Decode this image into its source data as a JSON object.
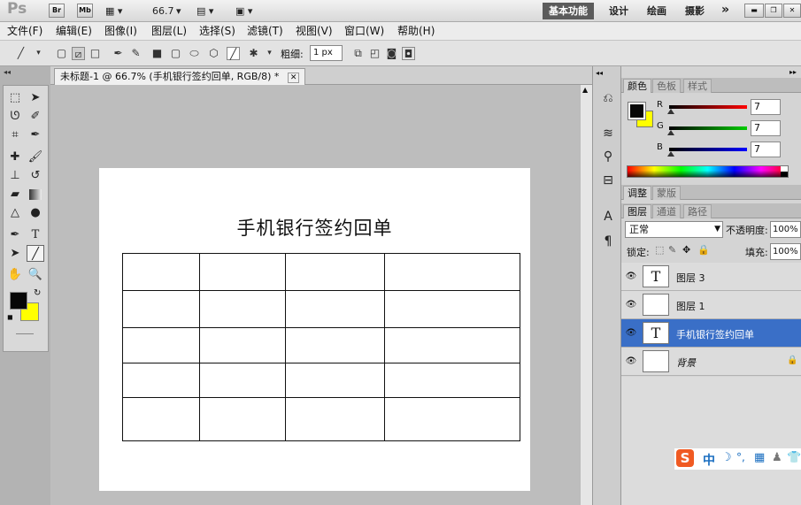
{
  "app": {
    "logo": "Ps",
    "bridge": "Br",
    "minibridge": "Mb",
    "zoom": "66.7",
    "workspaces": [
      "基本功能",
      "设计",
      "绘画",
      "摄影"
    ],
    "more": "»"
  },
  "menu": [
    "文件(F)",
    "编辑(E)",
    "图像(I)",
    "图层(L)",
    "选择(S)",
    "滤镜(T)",
    "视图(V)",
    "窗口(W)",
    "帮助(H)"
  ],
  "options": {
    "weight_label": "粗细:",
    "weight_value": "1 px"
  },
  "document": {
    "tab_title": "未标题-1 @ 66.7% (手机银行签约回单, RGB/8) *",
    "heading": "手机银行签约回单"
  },
  "color_panel": {
    "tabs": [
      "颜色",
      "色板",
      "样式"
    ],
    "r_label": "R",
    "g_label": "G",
    "b_label": "B",
    "r": "7",
    "g": "7",
    "b": "7",
    "foreground": "#070707",
    "background": "#ffff00"
  },
  "adjust_panel": {
    "tabs": [
      "调整",
      "蒙版"
    ]
  },
  "layers_panel": {
    "tabs": [
      "图层",
      "通道",
      "路径"
    ],
    "blend_mode": "正常",
    "opacity_label": "不透明度:",
    "opacity": "100%",
    "lock_label": "锁定:",
    "fill_label": "填充:",
    "fill": "100%",
    "layers": [
      {
        "name": "图层 3",
        "thumb": "T"
      },
      {
        "name": "图层 1",
        "thumb": ""
      },
      {
        "name": "手机银行签约回单",
        "thumb": "T"
      },
      {
        "name": "背景",
        "thumb": ""
      }
    ]
  },
  "ime": {
    "logo": "S",
    "label": "中"
  }
}
